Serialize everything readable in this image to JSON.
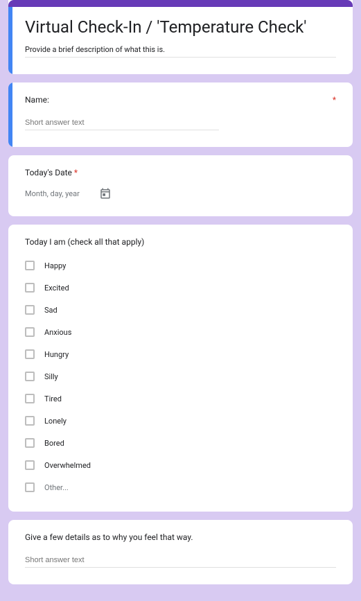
{
  "header": {
    "title": "Virtual Check-In / 'Temperature Check'",
    "description": "Provide a brief description of what this is."
  },
  "q1": {
    "label": "Name:",
    "required_mark": "*",
    "placeholder": "Short answer text"
  },
  "q2": {
    "label": "Today's Date",
    "required_mark": "*",
    "placeholder": "Month, day, year"
  },
  "q3": {
    "label": "Today I am  (check all that apply)",
    "options": {
      "o0": "Happy",
      "o1": "Excited",
      "o2": "Sad",
      "o3": "Anxious",
      "o4": "Hungry",
      "o5": "Silly",
      "o6": "Tired",
      "o7": "Lonely",
      "o8": "Bored",
      "o9": "Overwhelmed",
      "o10": "Other..."
    }
  },
  "q4": {
    "label": "Give a few details as to why you feel that way.",
    "placeholder": "Short answer text"
  }
}
